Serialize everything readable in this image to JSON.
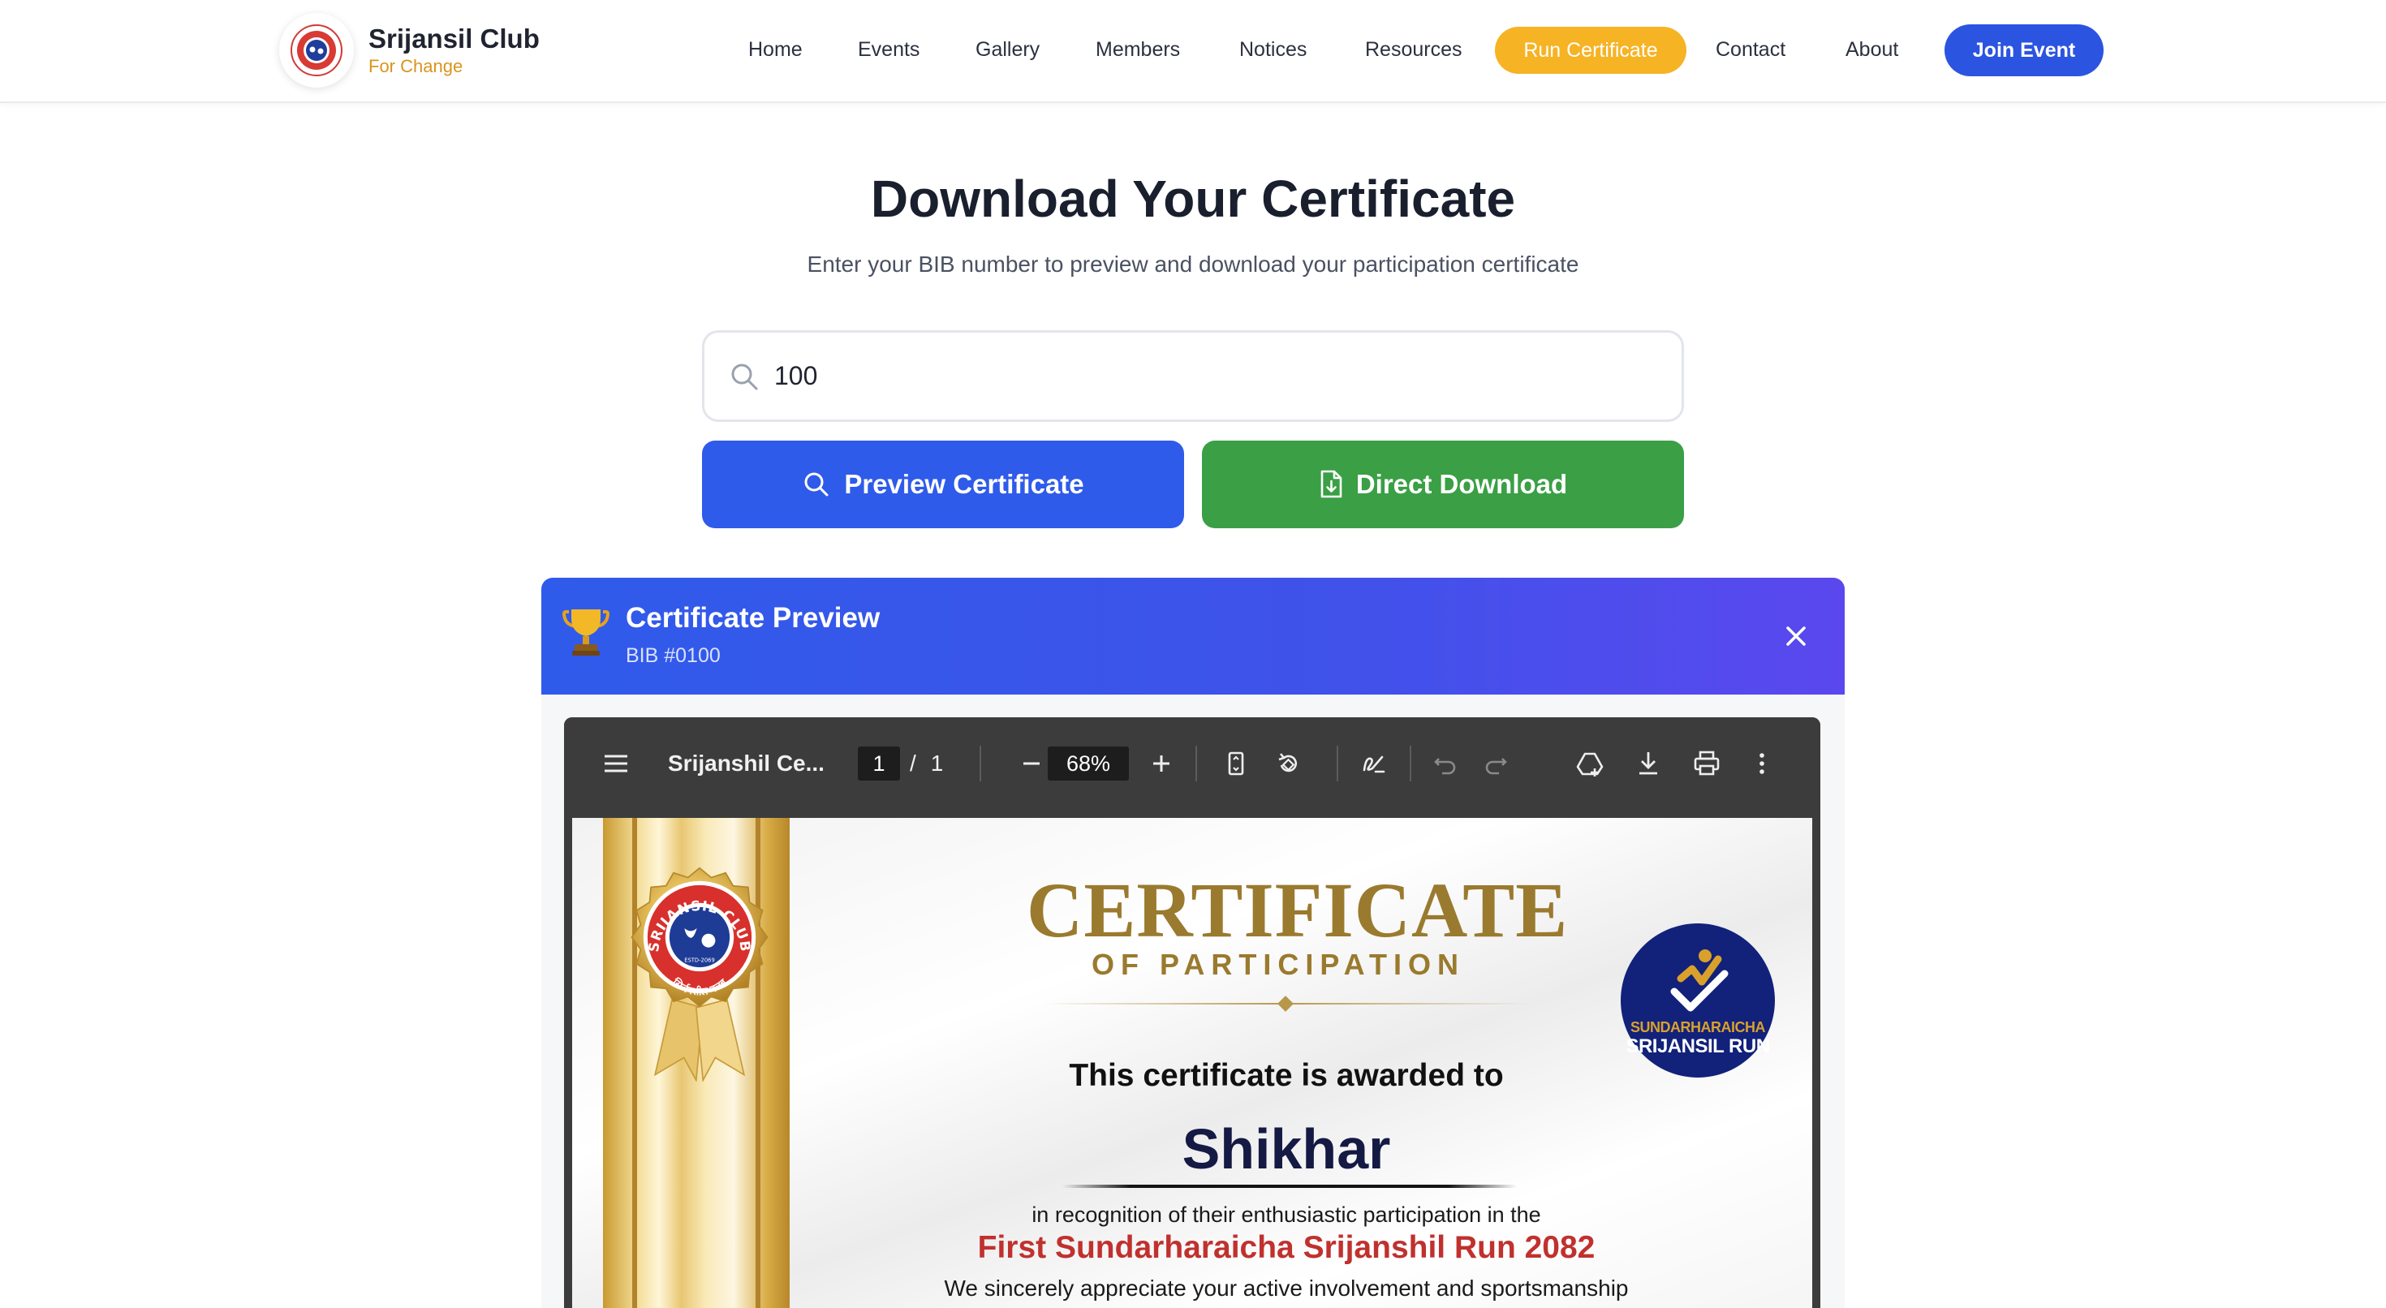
{
  "navbar": {
    "brand_name": "Srijansil Club",
    "brand_tagline": "For Change",
    "links": [
      "Home",
      "Events",
      "Gallery",
      "Members",
      "Notices",
      "Resources"
    ],
    "run_certificate": "Run Certificate",
    "contact": "Contact",
    "about": "About",
    "join_event": "Join Event",
    "accent_color": "#f6b324",
    "primary_color": "#2b54e0"
  },
  "hero": {
    "title": "Download Your Certificate",
    "subtitle": "Enter your BIB number to preview and download your participation certificate"
  },
  "search": {
    "value": "100",
    "icon": "search-icon"
  },
  "actions": {
    "preview_label": "Preview Certificate",
    "download_label": "Direct Download"
  },
  "preview": {
    "title": "Certificate Preview",
    "bib": "BIB #0100",
    "icon": "trophy-icon"
  },
  "viewer": {
    "doc_title": "Srijanshil Ce...",
    "page_current": "1",
    "page_separator": "/",
    "page_total": "1",
    "zoom": "68%"
  },
  "certificate": {
    "heading": "CERTIFICATE",
    "subheading": "OF PARTICIPATION",
    "awarded_to": "This certificate is awarded to",
    "recipient": "Shikhar",
    "recognition": "in recognition of their enthusiastic participation in the",
    "event_name": "First Sundarharaicha Srijanshil Run 2082",
    "appreciation": "We sincerely appreciate your active involvement and sportsmanship",
    "seal_text_top": "SRIJANSIL CLUB",
    "seal_text_bottom": "सिर्जनशील क्लब",
    "seal_estd": "ESTD-2069",
    "run_logo_line1": "SUNDARHARAICHA",
    "run_logo_line2": "SRIJANSIL RUN"
  }
}
